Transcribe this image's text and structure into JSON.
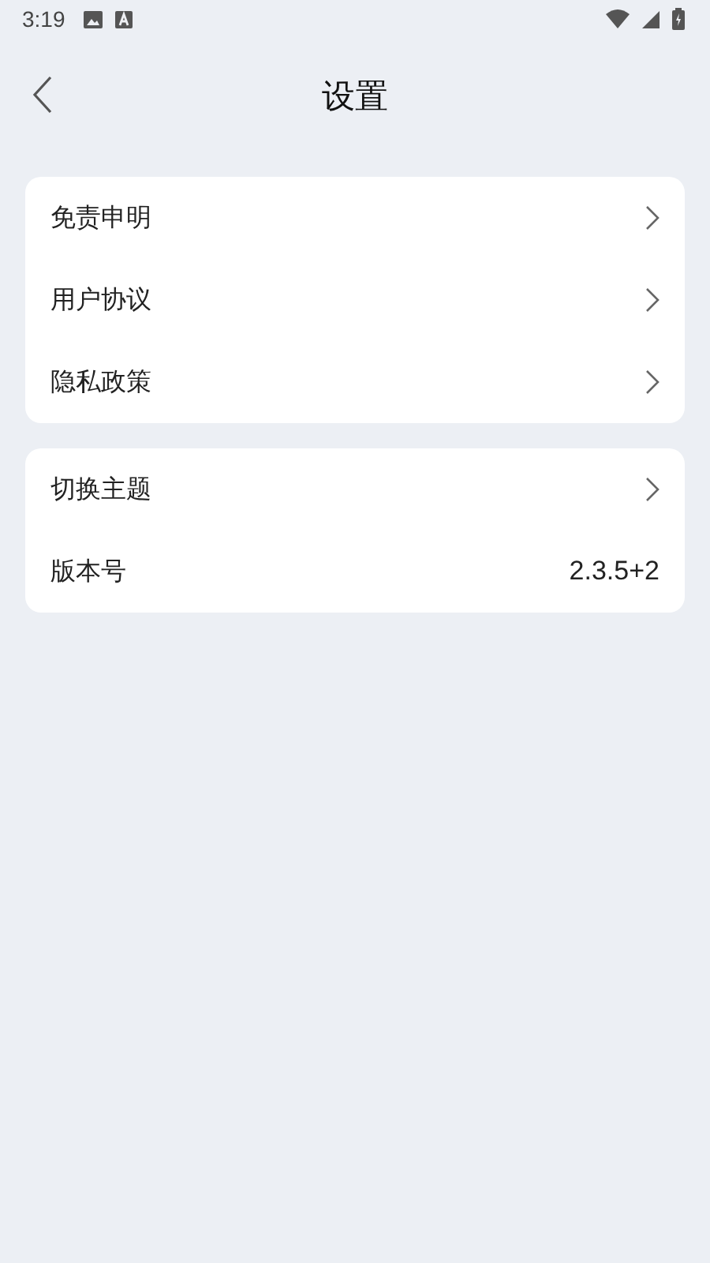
{
  "status_bar": {
    "time": "3:19"
  },
  "header": {
    "title": "设置"
  },
  "groups": [
    {
      "items": [
        {
          "kind": "link",
          "label": "免责申明"
        },
        {
          "kind": "link",
          "label": "用户协议"
        },
        {
          "kind": "link",
          "label": "隐私政策"
        }
      ]
    },
    {
      "items": [
        {
          "kind": "link",
          "label": "切换主题"
        },
        {
          "kind": "value",
          "label": "版本号",
          "value": "2.3.5+2"
        }
      ]
    }
  ]
}
